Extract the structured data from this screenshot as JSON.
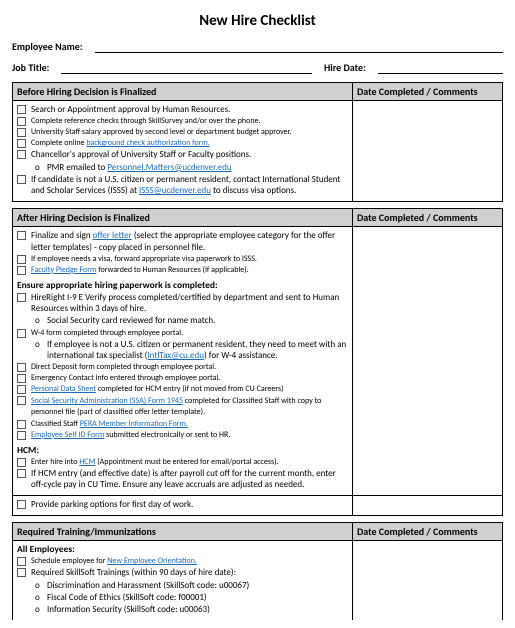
{
  "title": "New Hire Checklist",
  "fields": {
    "employee_name_label": "Employee Name:",
    "job_title_label": "Job Title:",
    "hire_date_label": "Hire Date:"
  },
  "section1": {
    "header": "Before Hiring Decision  is Finalized",
    "comments_header": "Date Completed / Comments",
    "items": {
      "i1": "Search or Appointment approval by Human Resources.",
      "i2": "Complete reference checks through SkillSurvey and/or over the phone.",
      "i3": "University Staff salary approved by second level or department budget approver.",
      "i4a": "Complete online ",
      "i4b": "background check authorization form.",
      "i5": "Chancellor's approval of University Staff or Faculty positions.",
      "i5sub_a": "PMR emailed to ",
      "i5sub_b": "Personnel.Matters@ucdenver.edu",
      "i6a": "If candidate is not a U.S. citizen or permanent resident, contact International Student and Scholar Services (ISSS) at ",
      "i6b": "ISSS@ucdenver.edu",
      "i6c": " to discuss visa options."
    }
  },
  "section2": {
    "header": "After Hiring Decision  is Finalized",
    "comments_header": "Date Completed / Comments",
    "items": {
      "i1a": "Finalize and sign ",
      "i1b": "offer letter",
      "i1c": " (select the appropriate employee category for the offer letter templates) - copy placed in personnel file.",
      "i2": "If employee needs a visa, forward appropriate visa paperwork to ISSS.",
      "i3a": "Faculty Pledge Form",
      "i3b": " forwarded to Human Resources (if applicable).",
      "sub_heading": "Ensure appropriate  hiring  paperwork is completed:",
      "p1": "HireRight I-9 E Verify process completed/certified by department and sent to Human Resources within 3 days of hire.",
      "p1s": "Social Security card reviewed for name match.",
      "p2": "W-4 form completed through employee portal.",
      "p2s_a": "If employee is not a U.S. citizen or permanent resident, they need to meet with an international tax specialist (",
      "p2s_b": "IntlTax@cu.edu",
      "p2s_c": ") for W-4 assistance.",
      "p3": "Direct Deposit form completed through employee portal.",
      "p4": "Emergency Contact info entered through employee portal.",
      "p5a": "Personal Data Sheet",
      "p5b": " completed for HCM entry (if not moved from CU Careers)",
      "p6a": "Social Security Administration (SSA) Form 1945",
      "p6b": " completed for Classified Staff with copy to personnel file (part of classified offer letter template).",
      "p7a": "Classified Staff ",
      "p7b": "PERA Member Information Form.",
      "p8a": "Employee Self ID Form",
      "p8b": " submitted electronically or sent to HR.",
      "hcm_heading": "HCM:",
      "h1a": "Enter hire into ",
      "h1b": "HCM",
      "h1c": " (Appointment must be entered for email/portal access).",
      "h2": "If HCM entry (and effective date) is after payroll cut off for the current month, enter off-cycle pay in CU Time. Ensure any leave accruals are adjusted as needed.",
      "park": "Provide parking options for first day of work."
    }
  },
  "section3": {
    "header": "Required Training/Immunizations",
    "comments_header": "Date Completed / Comments",
    "all_emp": "All Employees:",
    "i1a": "Schedule employee for ",
    "i1b": "New Employee Orientation.",
    "i2": "Required SkillSoft Trainings (within 90 days of hire date):",
    "t1": "Discrimination and Harassment (SkillSoft code: u00067)",
    "t2": "Fiscal Code of Ethics (SkillSoft code: f00001)",
    "t3": "Information Security (SkillSoft code: u00063)"
  }
}
